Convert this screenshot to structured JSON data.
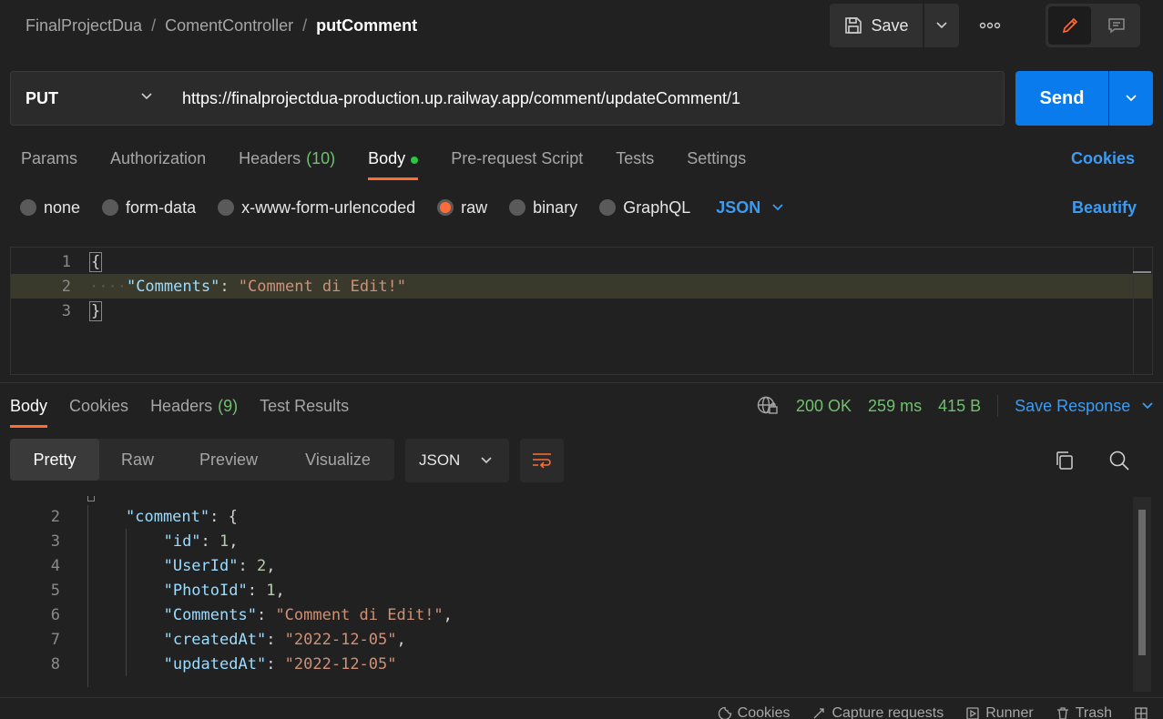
{
  "breadcrumb": {
    "items": [
      "FinalProjectDua",
      "ComentController"
    ],
    "current": "putComment",
    "separator": "/"
  },
  "toolbar": {
    "save_label": "Save"
  },
  "request": {
    "method": "PUT",
    "url": "https://finalprojectdua-production.up.railway.app/comment/updateComment/1",
    "send_label": "Send"
  },
  "request_tabs": [
    {
      "label": "Params",
      "count": ""
    },
    {
      "label": "Authorization",
      "count": ""
    },
    {
      "label": "Headers",
      "count": "(10)"
    },
    {
      "label": "Body",
      "count": ""
    },
    {
      "label": "Pre-request Script",
      "count": ""
    },
    {
      "label": "Tests",
      "count": ""
    },
    {
      "label": "Settings",
      "count": ""
    }
  ],
  "cookies_label": "Cookies",
  "body_types": [
    "none",
    "form-data",
    "x-www-form-urlencoded",
    "raw",
    "binary",
    "GraphQL"
  ],
  "body_language": "JSON",
  "beautify_label": "Beautify",
  "request_body": {
    "line_numbers": [
      "1",
      "2",
      "3"
    ],
    "open_brace": "{",
    "key": "\"Comments\"",
    "colon": ": ",
    "value": "\"Comment di Edit!\"",
    "close_brace": "}"
  },
  "response_tabs": [
    {
      "label": "Body",
      "count": ""
    },
    {
      "label": "Cookies",
      "count": ""
    },
    {
      "label": "Headers",
      "count": "(9)"
    },
    {
      "label": "Test Results",
      "count": ""
    }
  ],
  "response_meta": {
    "status": "200 OK",
    "time": "259 ms",
    "size": "415 B",
    "save_response": "Save Response"
  },
  "response_views": [
    "Pretty",
    "Raw",
    "Preview",
    "Visualize"
  ],
  "response_language": "JSON",
  "response_body": {
    "lines": [
      {
        "n": "2",
        "key": "\"comment\"",
        "value": "{",
        "kind": "p",
        "indent": 1,
        "comma": ""
      },
      {
        "n": "3",
        "key": "\"id\"",
        "value": "1",
        "kind": "n",
        "indent": 2,
        "comma": ","
      },
      {
        "n": "4",
        "key": "\"UserId\"",
        "value": "2",
        "kind": "n",
        "indent": 2,
        "comma": ","
      },
      {
        "n": "5",
        "key": "\"PhotoId\"",
        "value": "1",
        "kind": "n",
        "indent": 2,
        "comma": ","
      },
      {
        "n": "6",
        "key": "\"Comments\"",
        "value": "\"Comment di Edit!\"",
        "kind": "s",
        "indent": 2,
        "comma": ","
      },
      {
        "n": "7",
        "key": "\"createdAt\"",
        "value": "\"2022-12-05\"",
        "kind": "s",
        "indent": 2,
        "comma": ","
      },
      {
        "n": "8",
        "key": "\"updatedAt\"",
        "value": "\"2022-12-05\"",
        "kind": "s",
        "indent": 2,
        "comma": ""
      }
    ]
  },
  "statusbar": [
    "Cookies",
    "Capture requests",
    "Runner",
    "Trash"
  ],
  "colors": {
    "accent": "#ff6c37",
    "send": "#097bed",
    "link": "#3d9bf2",
    "ok": "#6ec26e"
  },
  "icons": [
    "save-icon",
    "chevron-down-icon",
    "more-icon",
    "pencil-icon",
    "comment-icon",
    "globe-lock-icon",
    "wrap-lines-icon",
    "copy-icon",
    "search-icon",
    "cookie-icon",
    "capture-icon",
    "runner-icon",
    "trash-icon",
    "layout-icon"
  ]
}
